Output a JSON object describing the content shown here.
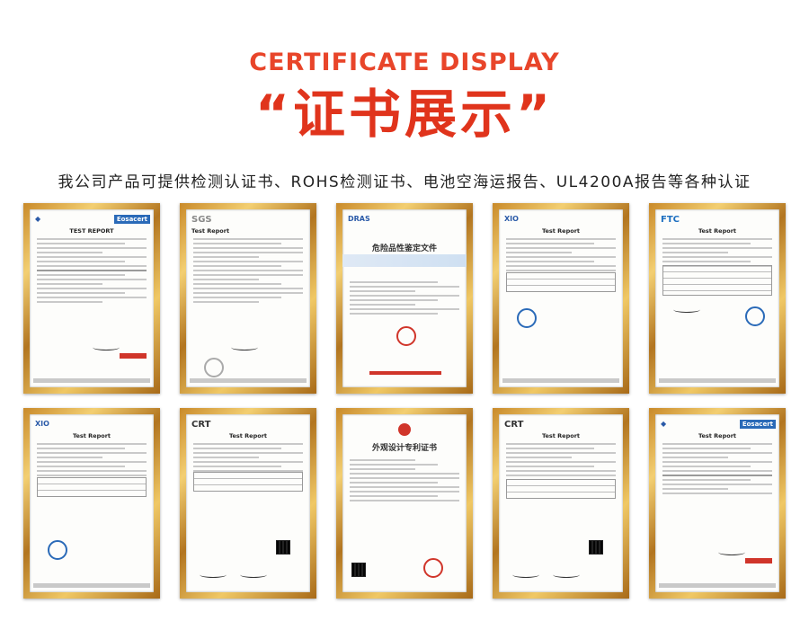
{
  "header": {
    "title_en": "CERTIFICATE DISPLAY",
    "title_cn": "“证书展示”",
    "subtitle": "我公司产品可提供检测认证书、ROHS检测证书、电池空海运报告、UL4200A报告等各种认证"
  },
  "certificates": [
    {
      "logo": "",
      "badge": "Eosacert",
      "title": "TEST REPORT"
    },
    {
      "logo": "SGS",
      "badge": "",
      "title": "Test Report"
    },
    {
      "logo": "DRAS",
      "badge": "",
      "title": "危险品性鉴定文件"
    },
    {
      "logo": "XIO",
      "badge": "",
      "title": "Test Report"
    },
    {
      "logo": "FTC",
      "badge": "",
      "title": "Test Report"
    },
    {
      "logo": "XIO",
      "badge": "",
      "title": "Test Report"
    },
    {
      "logo": "CRT",
      "badge": "",
      "title": "Test Report"
    },
    {
      "logo": "",
      "badge": "",
      "title": "外观设计专利证书"
    },
    {
      "logo": "CRT",
      "badge": "",
      "title": "Test Report"
    },
    {
      "logo": "",
      "badge": "Eosacert",
      "title": "Test Report"
    }
  ],
  "colors": {
    "accent": "#e0341c",
    "frame_gold": "#d6a23e",
    "seal_red": "#d0352a"
  }
}
